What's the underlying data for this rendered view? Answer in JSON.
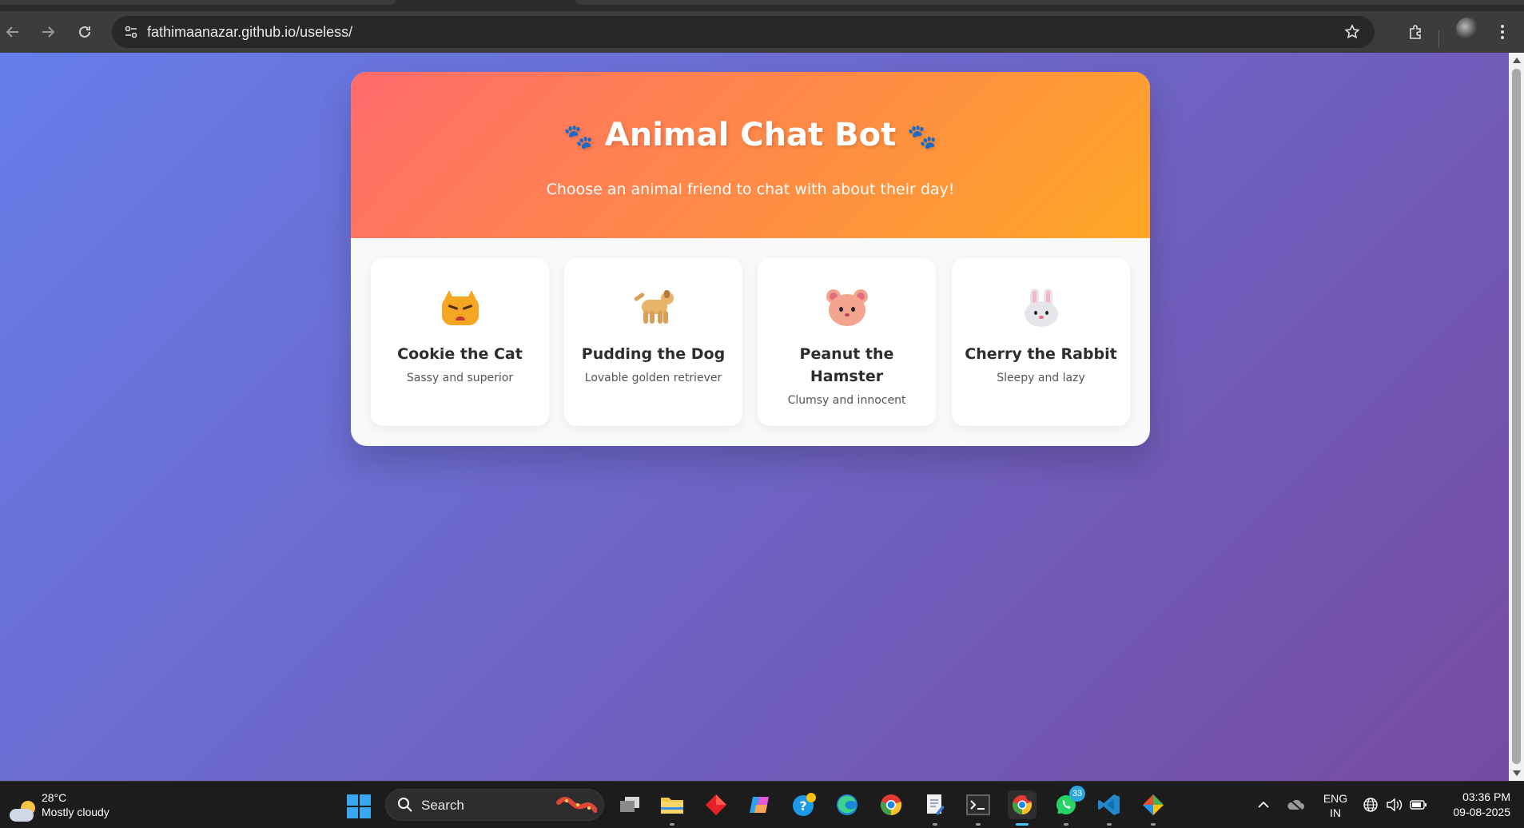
{
  "browser": {
    "url": "fathimaanazar.github.io/useless/"
  },
  "app": {
    "title": "Animal Chat Bot",
    "paw_glyph": "🐾",
    "subtitle": "Choose an animal friend to chat with about their day!",
    "header_gradient": [
      "#ff6b6b",
      "#ffa726"
    ],
    "page_gradient": [
      "#667eea",
      "#764ba2"
    ],
    "animals": [
      {
        "name": "Cookie the Cat",
        "desc": "Sassy and superior",
        "icon": "cat-face-icon"
      },
      {
        "name": "Pudding the Dog",
        "desc": "Lovable golden retriever",
        "icon": "dog-icon"
      },
      {
        "name": "Peanut the Hamster",
        "desc": "Clumsy and innocent",
        "icon": "hamster-face-icon"
      },
      {
        "name": "Cherry the Rabbit",
        "desc": "Sleepy and lazy",
        "icon": "rabbit-face-icon"
      }
    ]
  },
  "taskbar": {
    "weather_temp": "28°C",
    "weather_condition": "Mostly cloudy",
    "search_label": "Search",
    "whatsapp_badge": "33",
    "lang_line1": "ENG",
    "lang_line2": "IN",
    "time": "03:36 PM",
    "date": "09-08-2025"
  }
}
